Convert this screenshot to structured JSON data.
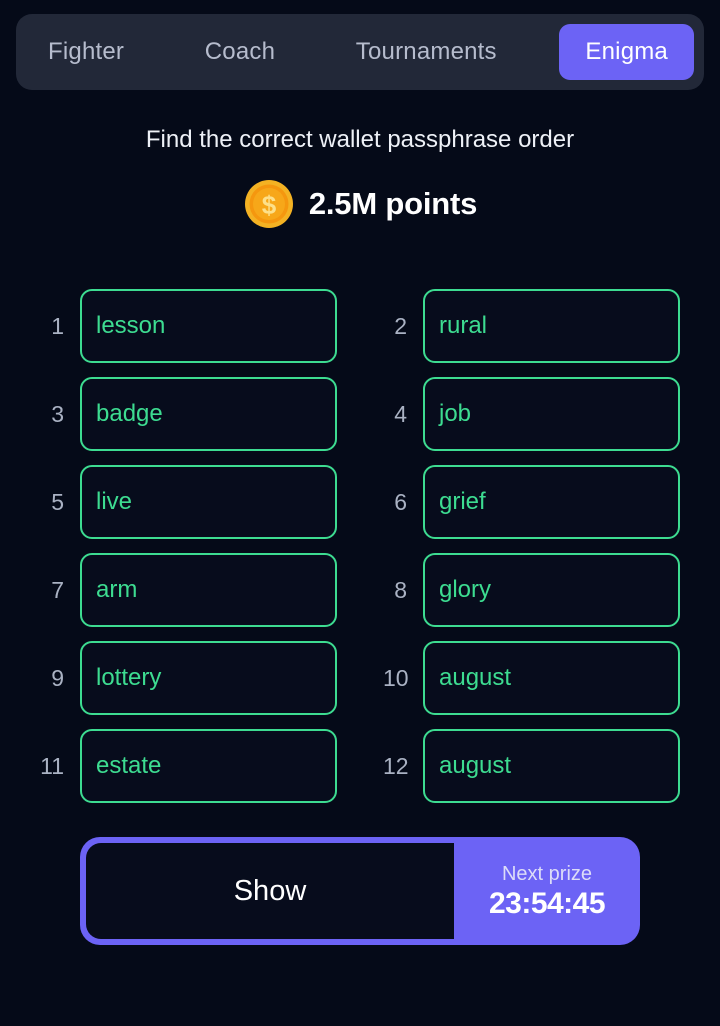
{
  "theme": {
    "page_background": "#050a18",
    "nav_background": "#222838",
    "accent_purple": "#6c63f5",
    "word_green": "#3ddc91",
    "muted_text": "#aab2c3"
  },
  "nav": {
    "tabs": [
      {
        "label": "Fighter",
        "active": false
      },
      {
        "label": "Coach",
        "active": false
      },
      {
        "label": "Tournaments",
        "active": false
      },
      {
        "label": "Enigma",
        "active": true
      }
    ]
  },
  "header": {
    "subtitle": "Find the correct wallet passphrase order",
    "coin_icon": "gold-coin-dollar-icon",
    "points": "2.5M points"
  },
  "passphrase": {
    "words": [
      {
        "index": "1",
        "word": "lesson"
      },
      {
        "index": "2",
        "word": "rural"
      },
      {
        "index": "3",
        "word": "badge"
      },
      {
        "index": "4",
        "word": "job"
      },
      {
        "index": "5",
        "word": "live"
      },
      {
        "index": "6",
        "word": "grief"
      },
      {
        "index": "7",
        "word": "arm"
      },
      {
        "index": "8",
        "word": "glory"
      },
      {
        "index": "9",
        "word": "lottery"
      },
      {
        "index": "10",
        "word": "august"
      },
      {
        "index": "11",
        "word": "estate"
      },
      {
        "index": "12",
        "word": "august"
      }
    ]
  },
  "footer": {
    "show_label": "Show",
    "prize_label": "Next prize",
    "prize_timer": "23:54:45"
  }
}
